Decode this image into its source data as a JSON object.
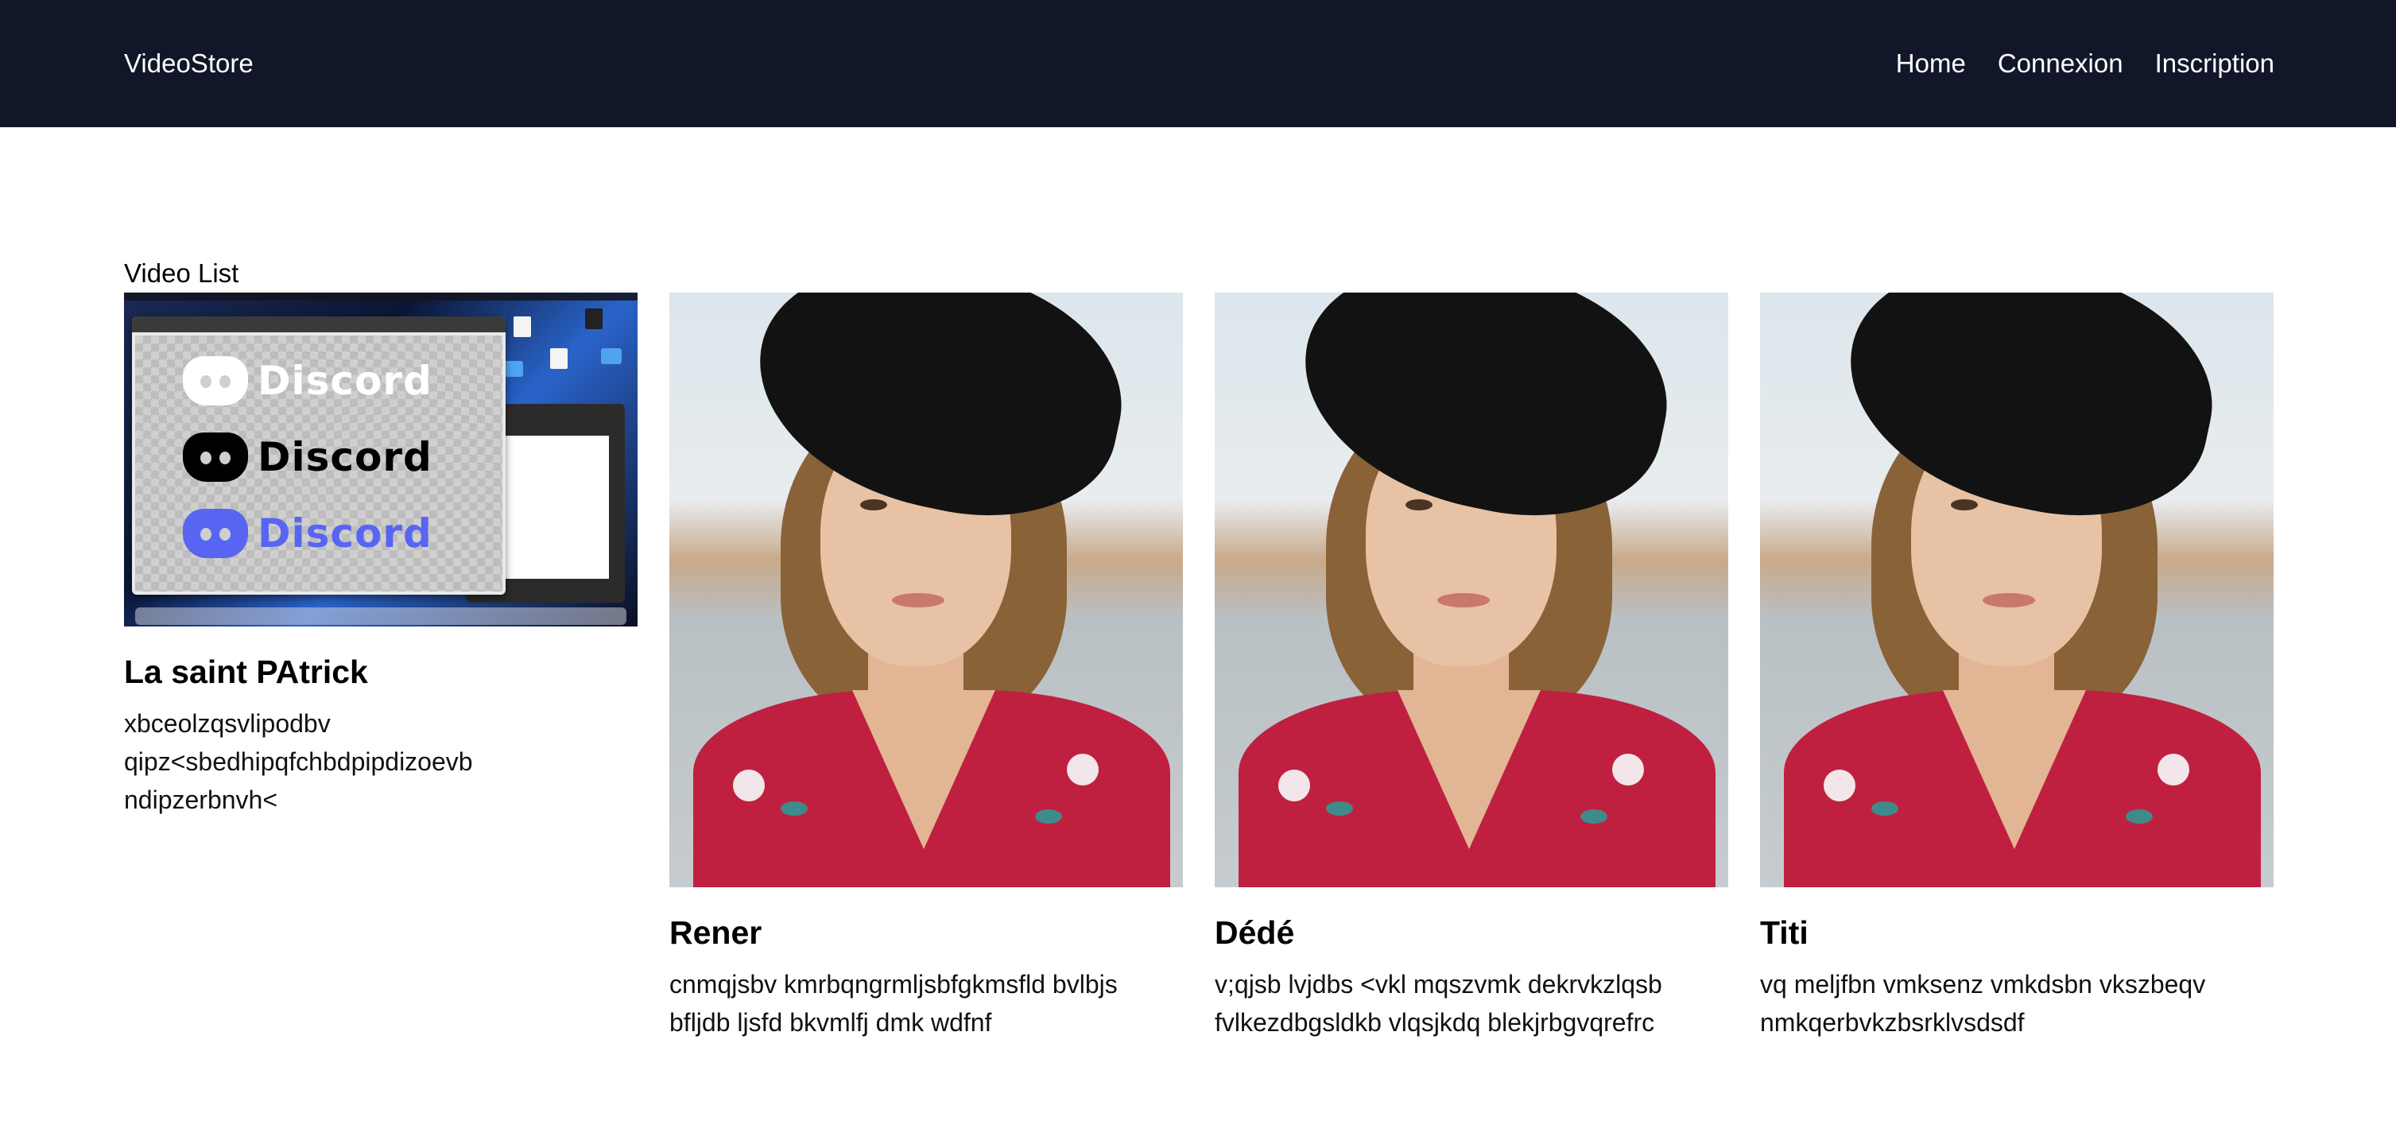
{
  "navbar": {
    "brand": "VideoStore",
    "links": [
      {
        "label": "Home"
      },
      {
        "label": "Connexion"
      },
      {
        "label": "Inscription"
      }
    ]
  },
  "main": {
    "section_title": "Video List",
    "videos": [
      {
        "title": "La saint PAtrick",
        "description": "xbceolzqsvlipodbv qipz<sbedhipqfchbdpipdizoevb ndipzerbnvh<",
        "thumbnail": "Discord logos screenshot",
        "thumbnail_text": [
          "Discord",
          "Discord",
          "Discord"
        ]
      },
      {
        "title": "Rener",
        "description": "cnmqjsbv kmrbqngrmljsbfgkmsfld bvlbjs bfljdb ljsfd bkvmlfj dmk wdfnf",
        "thumbnail": "portrait of woman in black hat"
      },
      {
        "title": "Dédé",
        "description": "v;qjsb lvjdbs <vkl mqszvmk dekrvkzlqsb fvlkezdbgsldkb vlqsjkdq blekjrbgvqrefrc",
        "thumbnail": "portrait of woman in black hat"
      },
      {
        "title": "Titi",
        "description": "vq meljfbn vmksenz vmkdsbn vkszbeqv nmkqerbvkzbsrklvsdsdf",
        "thumbnail": "portrait of woman in black hat"
      }
    ]
  },
  "colors": {
    "navbar_bg": "#111729",
    "discord_white": "#ffffff",
    "discord_black": "#000000",
    "discord_blurple": "#5865f2"
  }
}
